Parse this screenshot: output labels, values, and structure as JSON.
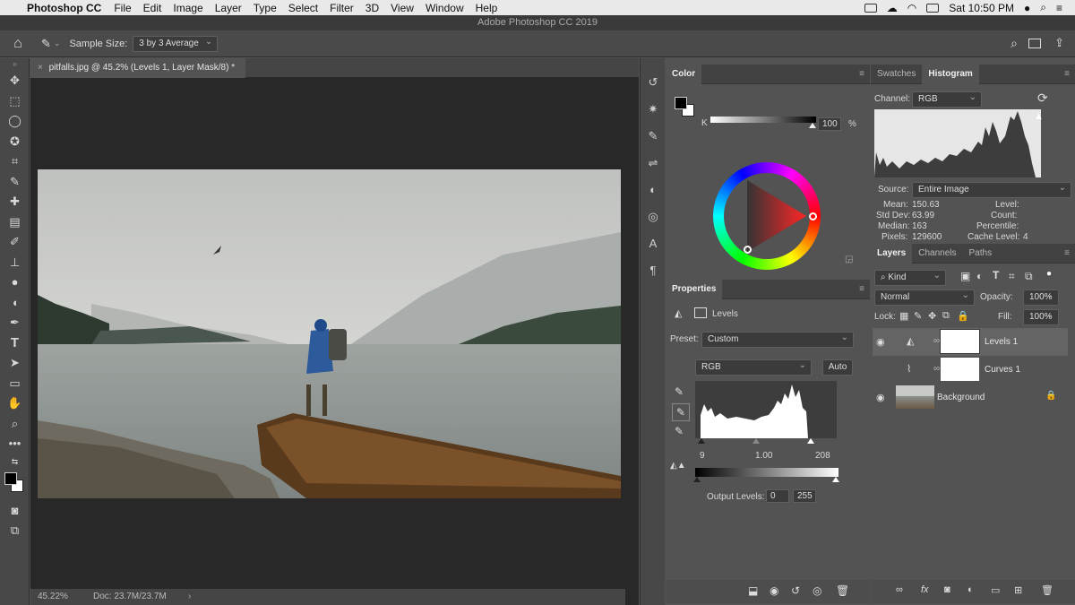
{
  "menubar": {
    "app": "Photoshop CC",
    "items": [
      "File",
      "Edit",
      "Image",
      "Layer",
      "Type",
      "Select",
      "Filter",
      "3D",
      "View",
      "Window",
      "Help"
    ],
    "clock": "Sat 10:50 PM"
  },
  "titlebar": {
    "title": "Adobe Photoshop CC 2019"
  },
  "options": {
    "sample_size_label": "Sample Size:",
    "sample_size_value": "3 by 3 Average"
  },
  "document": {
    "tab_title": "pitfalls.jpg @ 45.2% (Levels 1, Layer Mask/8) *",
    "zoom": "45.22%",
    "doc_size": "Doc: 23.7M/23.7M"
  },
  "color_panel": {
    "tab": "Color",
    "k_label": "K",
    "k_value": "100",
    "percent": "%"
  },
  "histogram_panel": {
    "tabs": [
      "Swatches",
      "Histogram"
    ],
    "channel_label": "Channel:",
    "channel_value": "RGB",
    "source_label": "Source:",
    "source_value": "Entire Image",
    "stats": [
      {
        "label": "Mean:",
        "value": "150.63"
      },
      {
        "label": "Std Dev:",
        "value": "63.99"
      },
      {
        "label": "Median:",
        "value": "163"
      },
      {
        "label": "Pixels:",
        "value": "129600"
      }
    ],
    "stats_right": [
      {
        "label": "Level:",
        "value": ""
      },
      {
        "label": "Count:",
        "value": ""
      },
      {
        "label": "Percentile:",
        "value": ""
      },
      {
        "label": "Cache Level:",
        "value": "4"
      }
    ]
  },
  "properties_panel": {
    "tab": "Properties",
    "adjustment": "Levels",
    "preset_label": "Preset:",
    "preset_value": "Custom",
    "channel_value": "RGB",
    "auto_label": "Auto",
    "input_black": "9",
    "input_gamma": "1.00",
    "input_white": "208",
    "output_label": "Output Levels:",
    "output_black": "0",
    "output_white": "255"
  },
  "layers_panel": {
    "tabs": [
      "Layers",
      "Channels",
      "Paths"
    ],
    "kind": "Kind",
    "blend_mode": "Normal",
    "opacity_label": "Opacity:",
    "opacity_value": "100%",
    "lock_label": "Lock:",
    "fill_label": "Fill:",
    "fill_value": "100%",
    "layers": [
      {
        "name": "Levels 1"
      },
      {
        "name": "Curves 1"
      },
      {
        "name": "Background"
      }
    ]
  },
  "colors": {
    "accent_white": "#ffffff",
    "panel_bg": "#535353",
    "canvas_bg": "#282828"
  }
}
